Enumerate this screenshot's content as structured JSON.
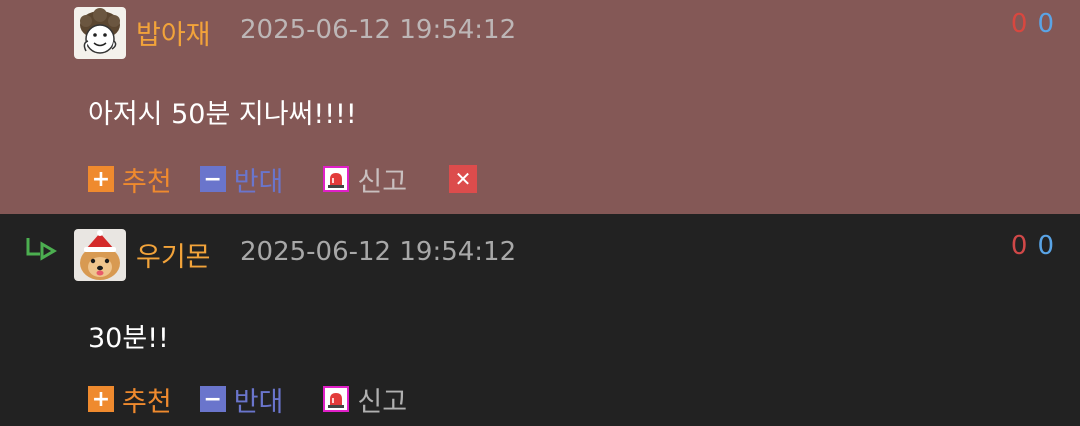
{
  "comments": [
    {
      "nick": "밥아재",
      "date": "2025-06-12 19:54:12",
      "upvotes": "0",
      "downvotes": "0",
      "text": "아저시 50분 지나써!!!!",
      "recommend_label": "추천",
      "oppose_label": "반대",
      "report_label": "신고",
      "avatar_icon": "doodle-character-avatar",
      "has_delete": true
    },
    {
      "nick": "우기몬",
      "date": "2025-06-12 19:54:12",
      "upvotes": "0",
      "downvotes": "0",
      "text": "30분!!",
      "recommend_label": "추천",
      "oppose_label": "반대",
      "report_label": "신고",
      "avatar_icon": "dog-santa-hat-avatar",
      "is_reply": true
    }
  ],
  "icons": {
    "recommend": "plus-icon",
    "oppose": "minus-icon",
    "report": "siren-icon",
    "delete": "close-icon",
    "reply": "reply-arrow-icon"
  },
  "colors": {
    "highlight_bg": "#845856",
    "page_bg": "#222222",
    "nick": "#f2a33a",
    "recommend": "#ef8a2e",
    "oppose": "#6a75cc",
    "report_border": "#e020c8",
    "upvote": "#d04848",
    "downvote": "#5aa4e6",
    "delete_bg": "#dc4c4c"
  }
}
